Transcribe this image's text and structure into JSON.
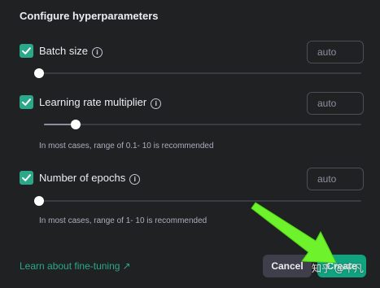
{
  "dialog": {
    "section_title": "Configure hyperparameters"
  },
  "hyperparameters": [
    {
      "label": "Batch size",
      "checked": true,
      "value_placeholder": "auto",
      "slider_fraction": 0.0,
      "hint": ""
    },
    {
      "label": "Learning rate multiplier",
      "checked": true,
      "value_placeholder": "auto",
      "slider_fraction": 0.1,
      "hint": "In most cases, range of 0.1- 10 is recommended"
    },
    {
      "label": "Number of epochs",
      "checked": true,
      "value_placeholder": "auto",
      "slider_fraction": 0.0,
      "hint": "In most cases, range of 1- 10 is recommended"
    }
  ],
  "footer": {
    "learn_link": "Learn about fine-tuning",
    "cancel_label": "Cancel",
    "create_label": "Create"
  },
  "icons": {
    "info": "info-icon",
    "check": "checkmark-icon",
    "external": "arrow-up-right-icon"
  },
  "overlay": {
    "watermark": "知乎 @千凡"
  },
  "colors": {
    "background": "#202123",
    "accent": "#10a37f",
    "checkbox": "#2aa889",
    "link": "#2aa889",
    "annotation_arrow": "#6df22b"
  }
}
